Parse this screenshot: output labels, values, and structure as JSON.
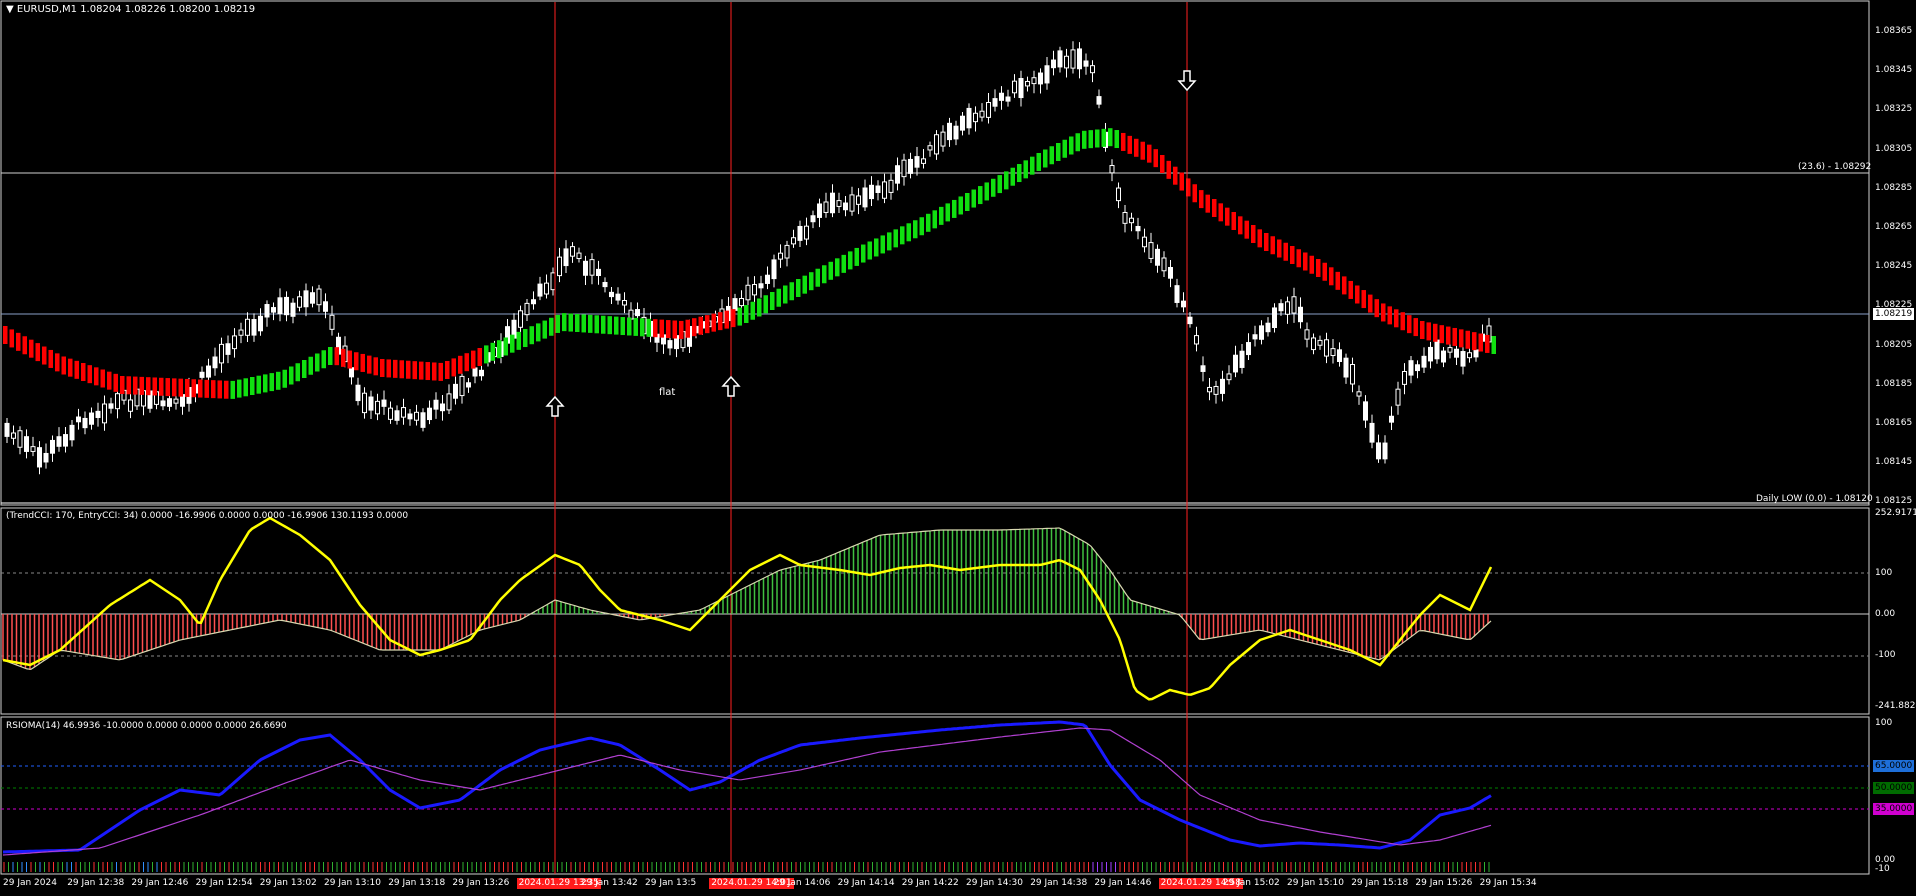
{
  "main": {
    "symbol_header": "EURUSD,M1  1.08204 1.08226 1.08200 1.08219",
    "price_ticks": [
      "1.08365",
      "1.08345",
      "1.08325",
      "1.08305",
      "1.08285",
      "1.08265",
      "1.08245",
      "1.08225",
      "1.08205",
      "1.08185",
      "1.08165",
      "1.08145",
      "1.08125"
    ],
    "current_price": "1.08219",
    "fib_label": "(23.6) - 1.08292",
    "daily_low_label": "Daily LOW (0.0) - 1.08120",
    "flat_label": "flat",
    "colors": {
      "bull": "#00e000",
      "bear": "#ff0000",
      "candle": "#ffffff",
      "vline": "#ff2020"
    }
  },
  "cci": {
    "header": "(TrendCCI: 170, EntryCCI: 34)  0.0000 -16.9906 0.0000 0.0000 -16.9906 130.1193 0.0000",
    "ticks": [
      "252.9171",
      "100",
      "0.00",
      "-100",
      "-241.8824"
    ]
  },
  "rsioma": {
    "header": "RSIOMA(14) 46.9936 -10.0000 0.0000 0.0000 0.0000 26.6690",
    "ticks": [
      "100",
      "0.00",
      "-10"
    ],
    "levels": [
      "65.0000",
      "50.0000",
      "35.0000"
    ],
    "level_colors": [
      "#2060ff",
      "#008000",
      "#d000d0"
    ]
  },
  "time_axis": {
    "labels": [
      "29 Jan 2024",
      "29 Jan 12:38",
      "29 Jan 12:46",
      "29 Jan 12:54",
      "29 Jan 13:02",
      "29 Jan 13:10",
      "29 Jan 13:18",
      "29 Jan 13:26",
      "2024.01.29 13:35",
      "29 Jan 13:42",
      "29 Jan 13:5",
      "2024.01.29 14:01",
      "29 Jan 14:06",
      "29 Jan 14:14",
      "29 Jan 14:22",
      "29 Jan 14:30",
      "29 Jan 14:38",
      "29 Jan 14:46",
      "2024.01.29 14:58",
      "29 Jan 15:02",
      "29 Jan 15:10",
      "29 Jan 15:18",
      "29 Jan 15:26",
      "29 Jan 15:34"
    ],
    "highlighted": [
      8,
      11,
      18
    ]
  }
}
